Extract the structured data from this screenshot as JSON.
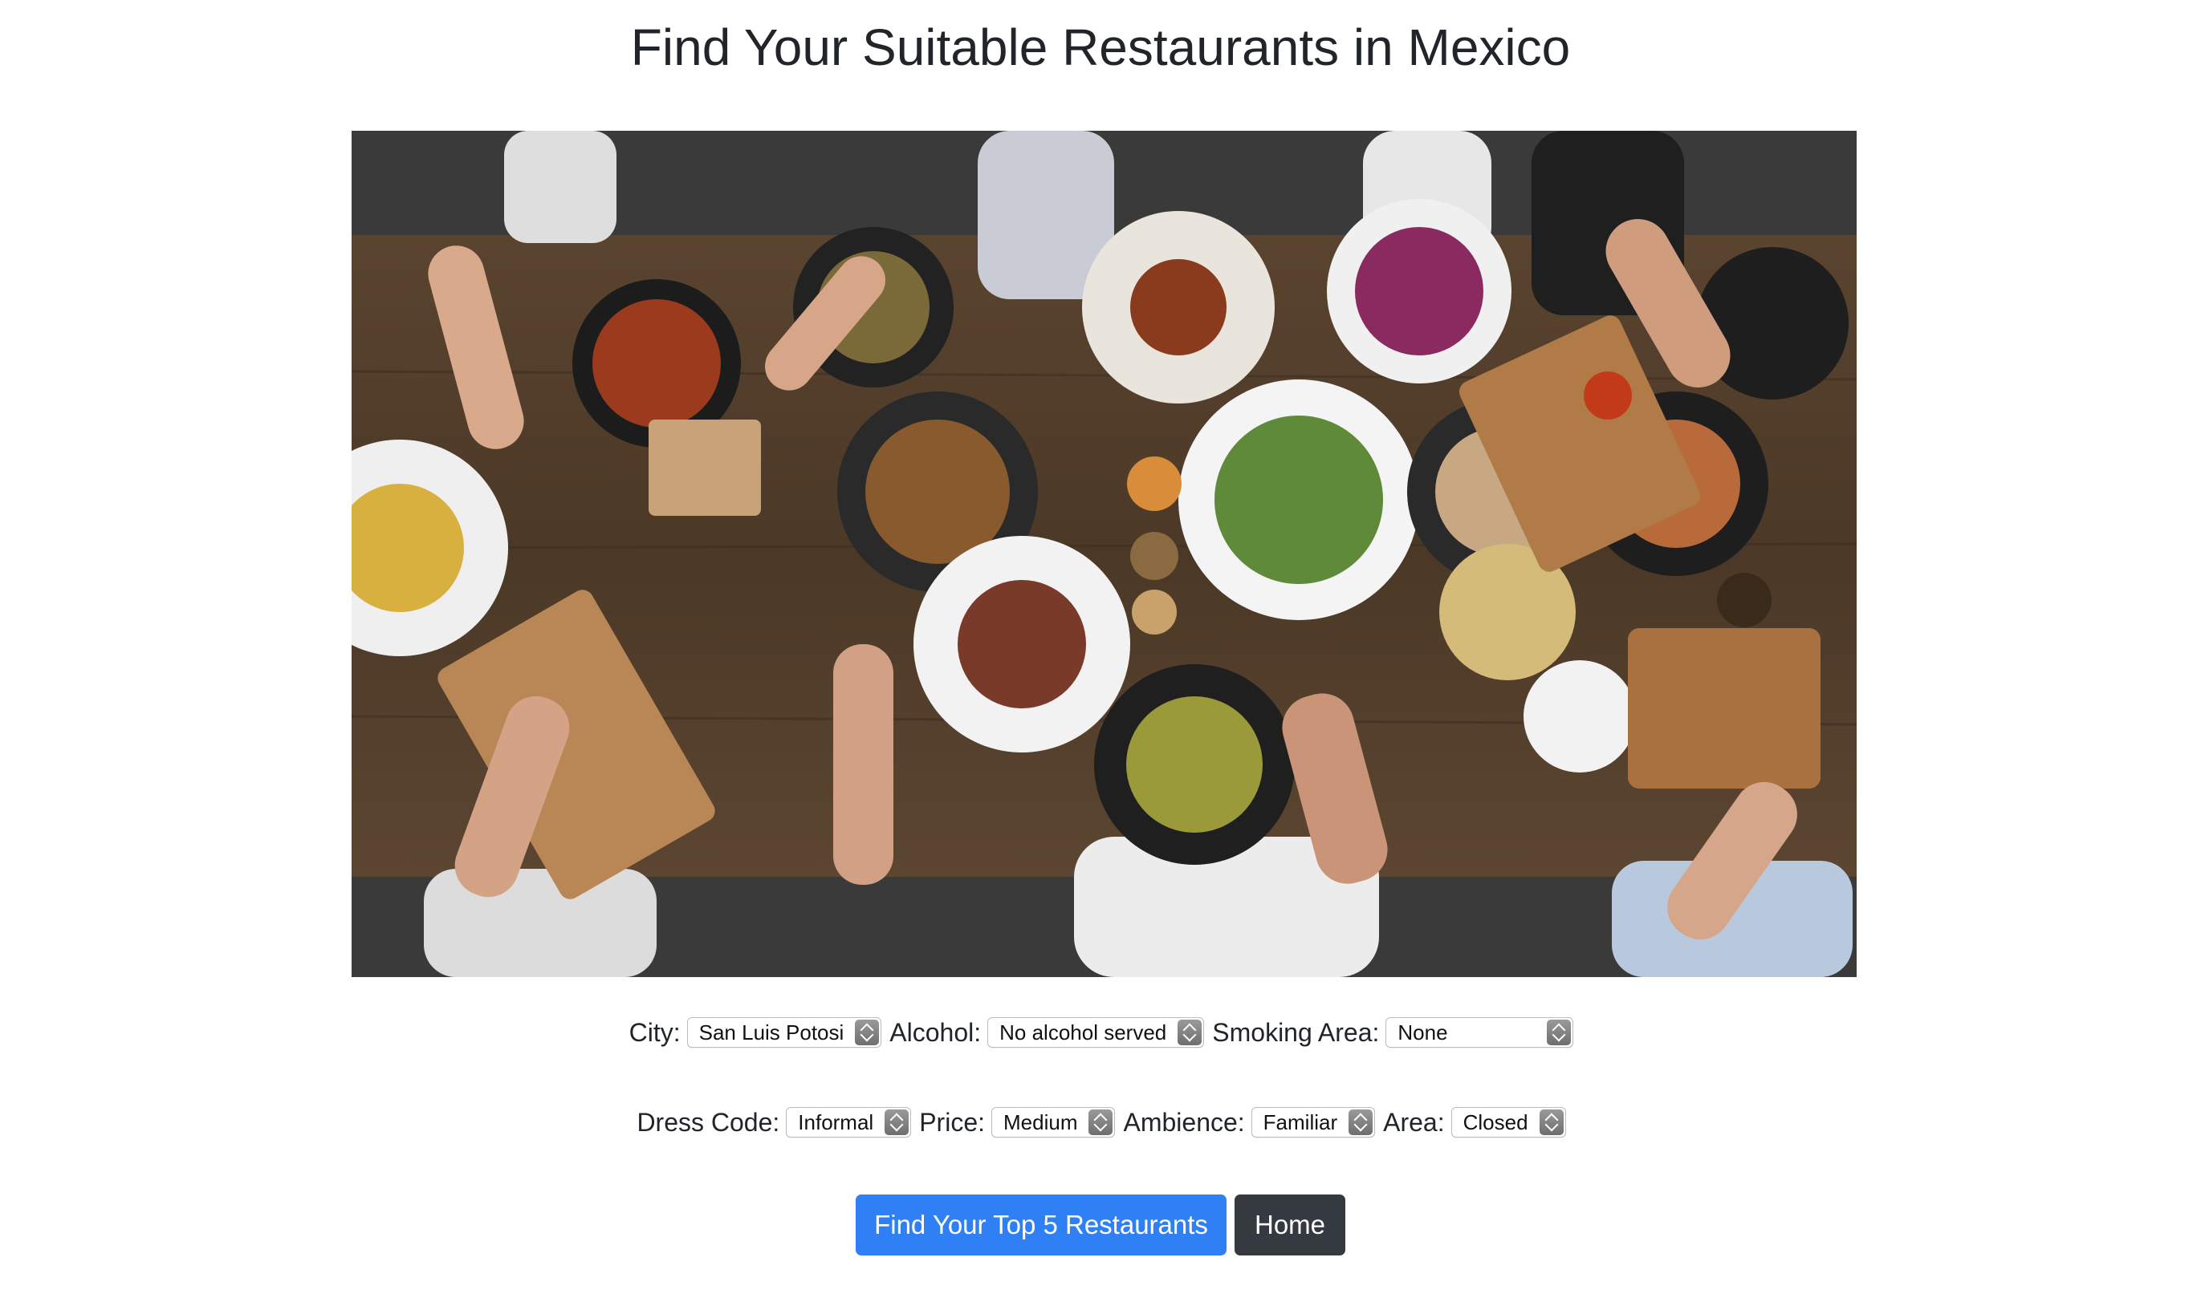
{
  "page": {
    "title": "Find Your Suitable Restaurants in Mexico"
  },
  "hero_image": {
    "icon": "food-table-photo"
  },
  "filters": {
    "city": {
      "label": "City:",
      "value": "San Luis Potosi"
    },
    "alcohol": {
      "label": "Alcohol:",
      "value": "No alcohol served"
    },
    "smoking_area": {
      "label": "Smoking Area:",
      "value": "None"
    },
    "dress_code": {
      "label": "Dress Code:",
      "value": "Informal"
    },
    "price": {
      "label": "Price:",
      "value": "Medium"
    },
    "ambience": {
      "label": "Ambience:",
      "value": "Familiar"
    },
    "area": {
      "label": "Area:",
      "value": "Closed"
    }
  },
  "buttons": {
    "find": "Find Your Top 5 Restaurants",
    "home": "Home"
  },
  "colors": {
    "primary": "#2f80f5",
    "dark": "#343a40",
    "text": "#212529"
  }
}
